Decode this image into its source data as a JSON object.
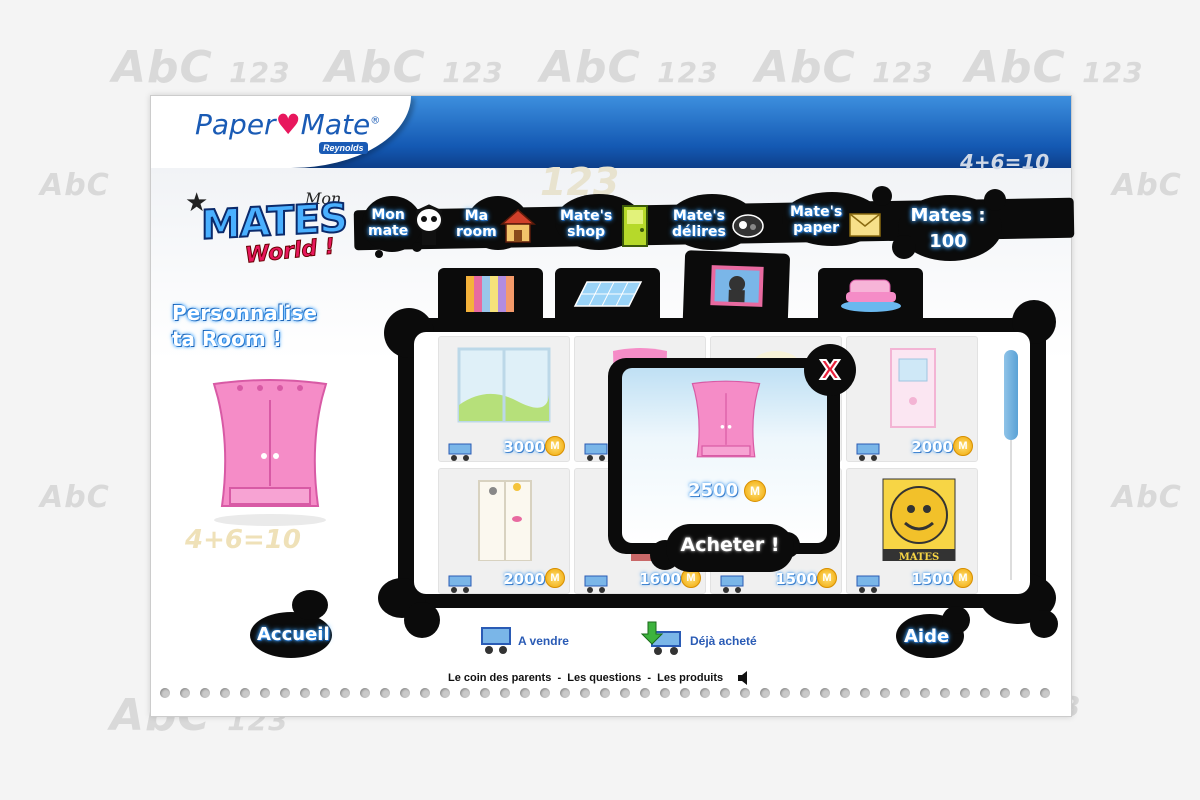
{
  "brand": {
    "logo_text_a": "Paper",
    "logo_text_b": "Mate",
    "sub_brand": "Reynolds",
    "game_prefix": "Mon",
    "game_title": "MATES",
    "game_subtitle": "World !"
  },
  "nav": {
    "items": [
      {
        "line1": "Mon",
        "line2": "mate",
        "icon": "mate-character-icon"
      },
      {
        "line1": "Ma",
        "line2": "room",
        "icon": "house-icon"
      },
      {
        "line1": "Mate's",
        "line2": "shop",
        "icon": "shop-door-icon"
      },
      {
        "line1": "Mate's",
        "line2": "délires",
        "icon": "game-icon"
      },
      {
        "line1": "Mate's",
        "line2": "paper",
        "icon": "envelope-icon"
      }
    ],
    "mates_label": "Mates :",
    "mates_value": "100"
  },
  "left_panel": {
    "title_line1": "Personnalise",
    "title_line2": "ta Room !",
    "preview_icon": "pink-wardrobe-icon"
  },
  "categories": [
    {
      "name": "wallpaper",
      "icon": "striped-wallpaper-icon"
    },
    {
      "name": "floor",
      "icon": "floor-tiles-icon"
    },
    {
      "name": "decor",
      "icon": "picture-frame-icon",
      "active": true
    },
    {
      "name": "furniture",
      "icon": "pink-armchair-icon"
    }
  ],
  "shop_items": [
    {
      "price": "3000",
      "icon": "window-landscape-icon"
    },
    {
      "price": "",
      "icon": "pink-wardrobe-icon"
    },
    {
      "price": "",
      "icon": "lamp-icon"
    },
    {
      "price": "2000",
      "icon": "pink-door-icon"
    },
    {
      "price": "2000",
      "icon": "white-wardrobe-icon"
    },
    {
      "price": "1600",
      "icon": "red-cabinet-icon"
    },
    {
      "price": "1500",
      "icon": "item-icon"
    },
    {
      "price": "1500",
      "icon": "mates-poster-icon",
      "poster_text": "MATES"
    }
  ],
  "coin_symbol": "M",
  "popup": {
    "price": "2500",
    "buy_label": "Acheter !",
    "close_label": "X",
    "item_icon": "pink-wardrobe-icon"
  },
  "bottom": {
    "home_label": "Accueil",
    "help_label": "Aide",
    "for_sale_label": "A vendre",
    "bought_label": "Déjà acheté"
  },
  "footer": {
    "links": [
      "Le coin des parents",
      "Les questions",
      "Les produits"
    ],
    "separator": "-",
    "speaker_icon": "speaker-icon"
  },
  "background": {
    "abc": "AbC",
    "num": "123",
    "equation": "4+6=10"
  },
  "colors": {
    "header_blue": "#1459b3",
    "glow_blue": "#3fa3ff",
    "accent_pink": "#e8175d",
    "panel_black": "#0b0b0b",
    "coin_gold": "#f0a500"
  }
}
